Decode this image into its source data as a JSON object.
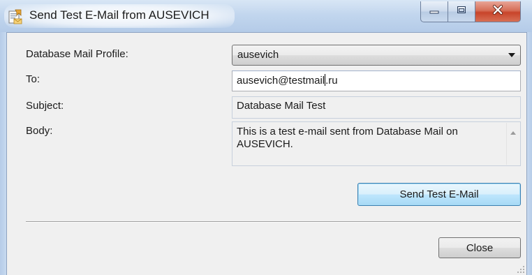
{
  "window": {
    "title": "Send Test E-Mail from AUSEVICH",
    "icon": "mail-icon"
  },
  "title_buttons": {
    "minimize": "minimize-icon",
    "maximize": "maximize-icon",
    "close": "close-icon"
  },
  "form": {
    "profile_label": "Database Mail Profile:",
    "profile_value": "ausevich",
    "to_label": "To:",
    "to_value_before_cursor": "ausevich@testmail",
    "to_value_after_cursor": ".ru",
    "subject_label": "Subject:",
    "subject_value": "Database Mail Test",
    "body_label": "Body:",
    "body_value": "This is a test e-mail sent from Database Mail on AUSEVICH."
  },
  "buttons": {
    "send_label": "Send Test E-Mail",
    "close_label": "Close"
  },
  "colors": {
    "titlebar": "#c2d6ee",
    "close_button": "#c8442a",
    "default_button_border": "#3c7fb1",
    "client_background": "#f0f0f0"
  }
}
